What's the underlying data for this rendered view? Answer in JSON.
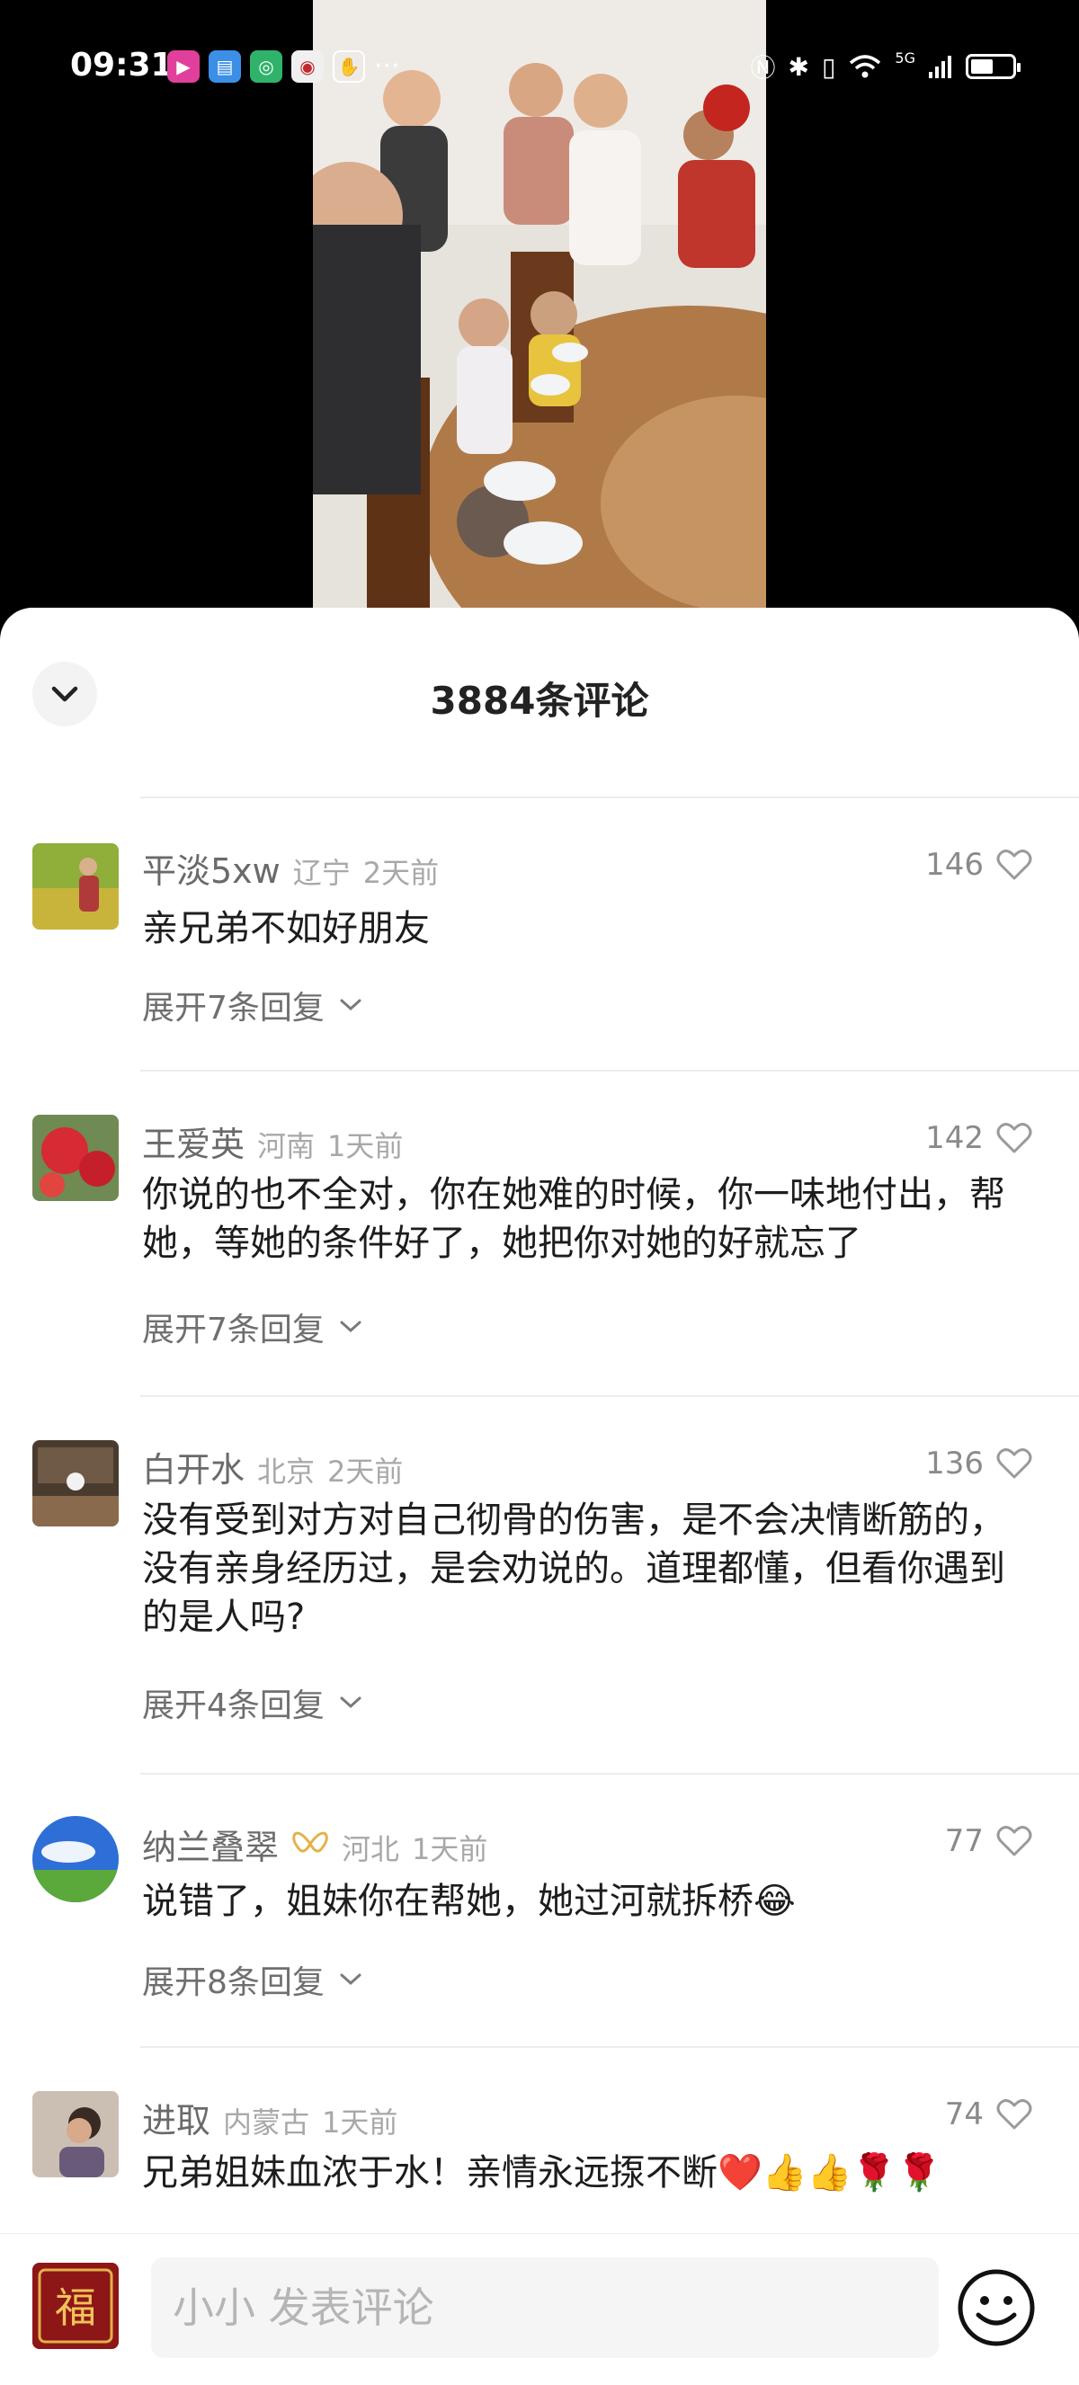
{
  "status_bar": {
    "time": "09:31",
    "app_icons": [
      "video-app-icon",
      "reader-app-icon",
      "browser-app-icon",
      "news-app-icon",
      "hand-app-icon"
    ],
    "more": "···",
    "network": "5G",
    "battery_level": 0.55
  },
  "video": {
    "description_icon": "video-frame"
  },
  "sheet": {
    "title": "3884条评论",
    "collapse_icon": "chevron-down-icon"
  },
  "comments": [
    {
      "user": "平淡5xw",
      "region": "辽宁",
      "time": "2天前",
      "likes": "146",
      "text": "亲兄弟不如好朋友",
      "replies": "展开7条回复"
    },
    {
      "user": "王爱英",
      "region": "河南",
      "time": "1天前",
      "likes": "142",
      "text": "你说的也不全对，你在她难的时候，你一味地付出，帮她，等她的条件好了，她把你对她的好就忘了",
      "replies": "展开7条回复"
    },
    {
      "user": "白开水",
      "region": "北京",
      "time": "2天前",
      "likes": "136",
      "text": "没有受到对方对自己彻骨的伤害，是不会决情断筋的，没有亲身经历过，是会劝说的。道理都懂，但看你遇到的是人吗?",
      "replies": "展开4条回复"
    },
    {
      "user": "纳兰叠翠",
      "region": "河北",
      "time": "1天前",
      "likes": "77",
      "text": "说错了，姐妹你在帮她，她过河就拆桥😂",
      "replies": "展开8条回复"
    },
    {
      "user": "进取",
      "region": "内蒙古",
      "time": "1天前",
      "likes": "74",
      "text": "兄弟姐妹血浓于水！亲情永远揼不断❤️👍👍🌹🌹",
      "replies": ""
    }
  ],
  "composer": {
    "placeholder": "小小 发表评论",
    "avatar_text": "福"
  },
  "colors": {
    "sheet_bg": "#ffffff",
    "username": "#6a6a6a",
    "meta": "#a8a8a8",
    "text": "#1d1d1d",
    "divider": "#ececec"
  }
}
